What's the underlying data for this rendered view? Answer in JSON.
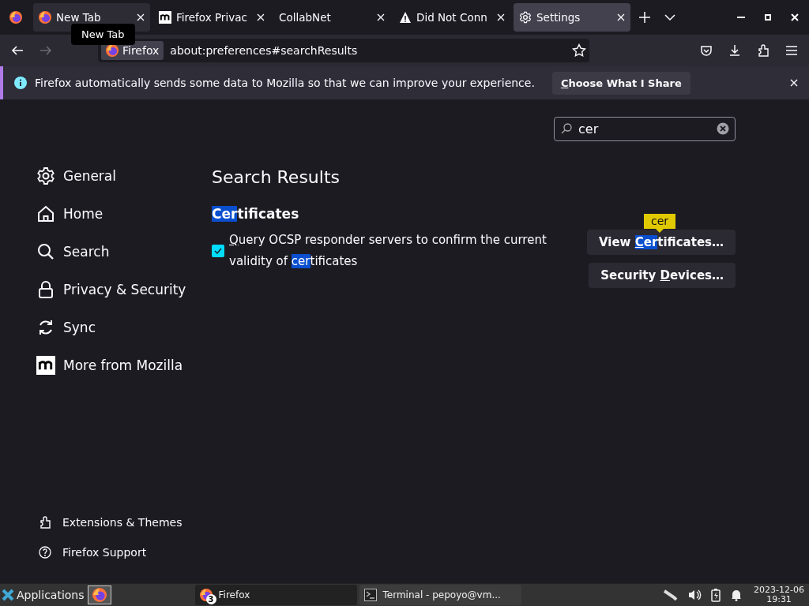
{
  "tab_bar": {
    "tabs": [
      {
        "title": "New Tab",
        "kind": "firefox",
        "selected": false,
        "hovered": true
      },
      {
        "title": "Firefox Privac",
        "kind": "mozilla",
        "selected": false,
        "hovered": false
      },
      {
        "title": "CollabNet",
        "kind": "none",
        "selected": false,
        "hovered": false
      },
      {
        "title": "Did Not Conn",
        "kind": "warning",
        "selected": false,
        "hovered": false
      },
      {
        "title": "Settings",
        "kind": "gear",
        "selected": true,
        "hovered": false
      }
    ],
    "tooltip": "New Tab"
  },
  "nav_bar": {
    "forward_disabled": true,
    "identity": "Firefox",
    "url": "about:preferences#searchResults"
  },
  "notification": {
    "message": "Firefox automatically sends some data to Mozilla so that we can improve your experience.",
    "button": [
      {
        "text": "C",
        "underlined": true,
        "highlighted": false
      },
      {
        "text": "hoose What I Share",
        "underlined": false,
        "highlighted": false
      }
    ]
  },
  "preferences": {
    "search": {
      "value": "cer"
    },
    "sidebar": {
      "categories": [
        {
          "label": "General",
          "kind": "gear",
          "selected": false
        },
        {
          "label": "Home",
          "kind": "home",
          "selected": false
        },
        {
          "label": "Search",
          "kind": "search",
          "selected": false
        },
        {
          "label": "Privacy & Security",
          "kind": "lock",
          "selected": false
        },
        {
          "label": "Sync",
          "kind": "sync",
          "selected": false
        },
        {
          "label": "More from Mozilla",
          "kind": "mozilla",
          "selected": false
        }
      ],
      "footer_links": [
        {
          "label": "Extensions & Themes",
          "kind": "puzzle"
        },
        {
          "label": "Firefox Support",
          "kind": "help"
        }
      ]
    },
    "heading": "Search Results",
    "group": {
      "title": [
        {
          "text": "Cer",
          "underlined": false,
          "highlighted": true
        },
        {
          "text": "tificates",
          "underlined": false,
          "highlighted": false
        }
      ],
      "checkbox": {
        "checked": true,
        "label": [
          {
            "text": "Q",
            "underlined": true,
            "highlighted": false
          },
          {
            "text": "uery OCSP responder servers to confirm the current validity of ",
            "underlined": false,
            "highlighted": false
          },
          {
            "text": "cer",
            "underlined": false,
            "highlighted": true
          },
          {
            "text": "tificates",
            "underlined": false,
            "highlighted": false
          }
        ]
      },
      "buttons": [
        {
          "label": [
            {
              "text": "View ",
              "underlined": false,
              "highlighted": false
            },
            {
              "text": "C",
              "underlined": true,
              "highlighted": true
            },
            {
              "text": "er",
              "underlined": false,
              "highlighted": true
            },
            {
              "text": "tificates…",
              "underlined": false,
              "highlighted": false
            }
          ]
        },
        {
          "label": [
            {
              "text": "Security ",
              "underlined": false,
              "highlighted": false
            },
            {
              "text": "D",
              "underlined": true,
              "highlighted": false
            },
            {
              "text": "evices…",
              "underlined": false,
              "highlighted": false
            }
          ]
        }
      ],
      "match_tooltip": "cer"
    }
  },
  "taskbar": {
    "menu": "Applications",
    "tasks": [
      {
        "title": "Firefox",
        "kind": "firefox",
        "badge": "3",
        "selected": true
      },
      {
        "title": "Terminal - pepoyo@vm...",
        "kind": "terminal",
        "selected": false
      }
    ],
    "date": "2023-12-06",
    "time": "19:31"
  }
}
